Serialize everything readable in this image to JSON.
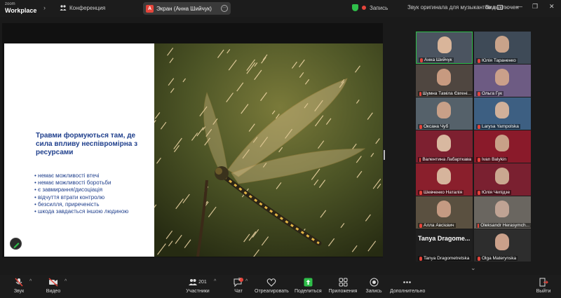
{
  "topbar": {
    "logo_line1": "zoom",
    "logo_line2": "Workplace",
    "conference_label": "Конференция",
    "share_badge": "A",
    "share_label": "Экран (Анна Шийчук)",
    "recording_label": "Запись",
    "audio_status": "Звук оригинала для музыкантов выключен",
    "view_label": "Вид"
  },
  "slide": {
    "title": "Травми формуються там, де сила впливу неспівромірна з ресурсами",
    "bullets": [
      "немає можливості втечі",
      "немає можливості боротьби",
      "є завмирання/дисоціація",
      "відчуття втрати контролю",
      "безсилля, приреченість",
      "шкода завдається іншою людиною"
    ]
  },
  "gallery": {
    "tiles": [
      {
        "name": "Анна Шийчук"
      },
      {
        "name": "Юлія Тараненко"
      },
      {
        "name": "Шумна Тамiла Євгенi..."
      },
      {
        "name": "Ольга Гук"
      },
      {
        "name": "Оксана Чуб"
      },
      {
        "name": "Larysa Yampolska"
      },
      {
        "name": "Валентина Лабарткава"
      },
      {
        "name": "Ivan Balykin"
      },
      {
        "name": "Шевченко Наталія"
      },
      {
        "name": "Юлія Чепідзе"
      },
      {
        "name": "Алла Авсієвич"
      },
      {
        "name": "Oleksandr Herasymch..."
      },
      {
        "name": "Tanya Dragometretska",
        "big": "Tanya Dragome..."
      },
      {
        "name": "Olga Materynska"
      }
    ]
  },
  "toolbar": {
    "audio": "Звук",
    "video": "Видео",
    "participants": "Участники",
    "participants_count": "201",
    "chat": "Чат",
    "chat_badge": "2",
    "react": "Отреагировать",
    "share": "Поделиться",
    "apps": "Приложения",
    "record": "Запись",
    "more": "Дополнительно",
    "leave": "Выйти"
  },
  "colors": {
    "accent_green": "#2fbf4a",
    "alert_red": "#e5453b",
    "slide_text": "#1f3f8c"
  }
}
